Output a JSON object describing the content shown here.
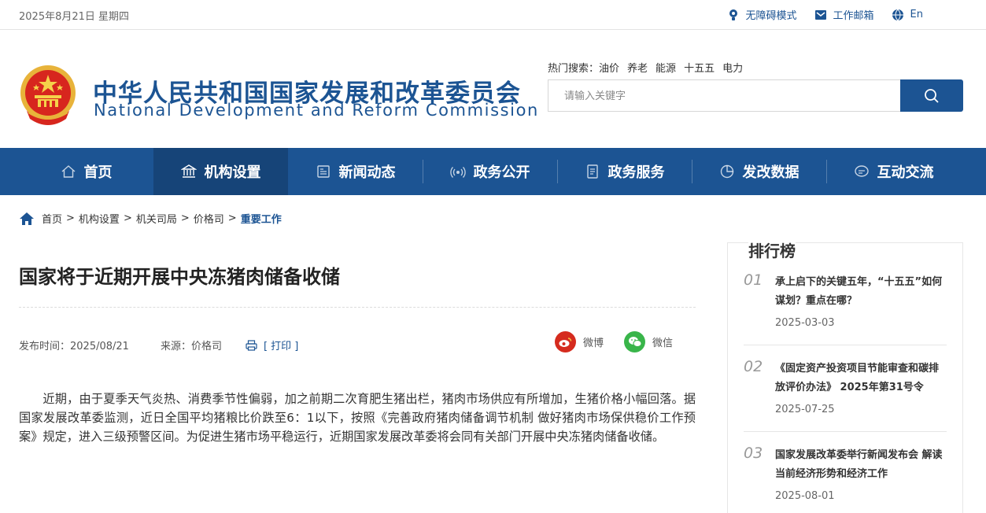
{
  "topbar": {
    "date": "2025年8月21日 星期四",
    "accessibility": "无障碍模式",
    "mail": "工作邮箱",
    "lang": "En"
  },
  "header": {
    "name_cn": "中华人民共和国国家发展和改革委员会",
    "name_en": "National Development and Reform Commission",
    "hot_label": "热门搜索：",
    "hot_keywords": [
      "油价",
      "养老",
      "能源",
      "十五五",
      "电力"
    ],
    "search_placeholder": "请输入关键字"
  },
  "nav": [
    "首页",
    "机构设置",
    "新闻动态",
    "政务公开",
    "政务服务",
    "发改数据",
    "互动交流"
  ],
  "breadcrumb": [
    "首页",
    "机构设置",
    "机关司局",
    "价格司",
    "重要工作"
  ],
  "article": {
    "title": "国家将于近期开展中央冻猪肉储备收储",
    "publish": "发布时间：2025/08/21",
    "source": "来源：价格司",
    "print": "[ 打印 ]",
    "share_weibo": "微博",
    "share_wechat": "微信",
    "body": "近期，由于夏季天气炎热、消费季节性偏弱，加之前期二次育肥生猪出栏，猪肉市场供应有所增加，生猪价格小幅回落。据国家发展改革委监测，近日全国平均猪粮比价跌至6：1以下，按照《完善政府猪肉储备调节机制 做好猪肉市场保供稳价工作预案》规定，进入三级预警区间。为促进生猪市场平稳运行，近期国家发展改革委将会同有关部门开展中央冻猪肉储备收储。"
  },
  "ranking": {
    "title": "排行榜",
    "items": [
      {
        "num": "01",
        "text": "承上启下的关键五年，“十五五”如何谋划？重点在哪？",
        "date": "2025-03-03"
      },
      {
        "num": "02",
        "text": "《固定资产投资项目节能审查和碳排放评价办法》 2025年第31号令",
        "date": "2025-07-25"
      },
      {
        "num": "03",
        "text": "国家发展改革委举行新闻发布会 解读当前经济形势和经济工作",
        "date": "2025-08-01"
      }
    ]
  },
  "colors": {
    "brand": "#1c5493",
    "nav_active": "#164478",
    "weibo": "#d52b1e",
    "wechat": "#39b54a"
  }
}
